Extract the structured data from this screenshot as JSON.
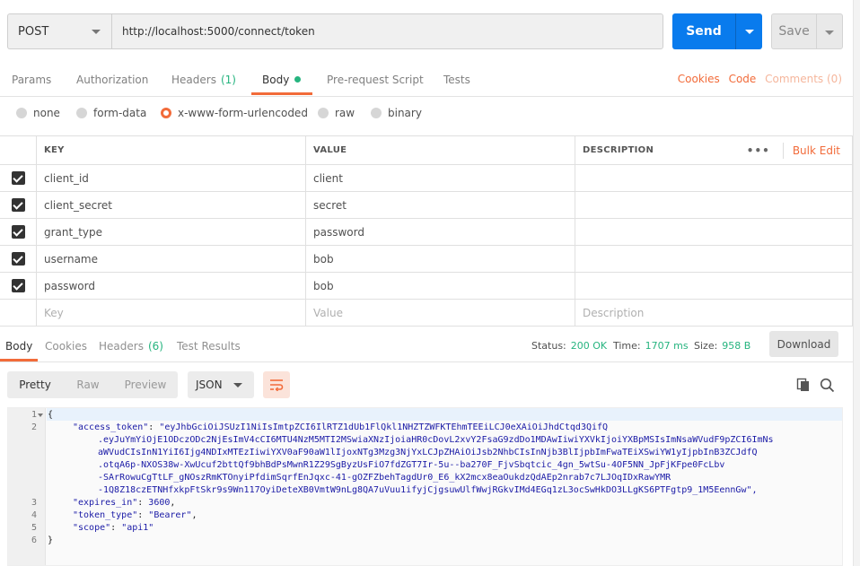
{
  "request": {
    "method": "POST",
    "url": "http://localhost:5000/connect/token",
    "send_label": "Send",
    "save_label": "Save"
  },
  "tabs": {
    "params": "Params",
    "authorization": "Authorization",
    "headers": "Headers",
    "headers_count": "(1)",
    "body": "Body",
    "prerequest": "Pre-request Script",
    "tests": "Tests",
    "cookies": "Cookies",
    "code": "Code",
    "comments": "Comments (0)"
  },
  "body_types": [
    "none",
    "form-data",
    "x-www-form-urlencoded",
    "raw",
    "binary"
  ],
  "body_type_selected": "x-www-form-urlencoded",
  "table": {
    "headers": {
      "key": "KEY",
      "value": "VALUE",
      "description": "DESCRIPTION"
    },
    "menu": "•••",
    "bulk_edit": "Bulk Edit",
    "rows": [
      {
        "key": "client_id",
        "value": "client",
        "description": ""
      },
      {
        "key": "client_secret",
        "value": "secret",
        "description": ""
      },
      {
        "key": "grant_type",
        "value": "password",
        "description": ""
      },
      {
        "key": "username",
        "value": "bob",
        "description": ""
      },
      {
        "key": "password",
        "value": "bob",
        "description": ""
      }
    ],
    "placeholder": {
      "key": "Key",
      "value": "Value",
      "description": "Description"
    }
  },
  "response": {
    "tabs": {
      "body": "Body",
      "cookies": "Cookies",
      "headers": "Headers",
      "headers_count": "(6)",
      "tests": "Test Results"
    },
    "status_label": "Status:",
    "status_value": "200 OK",
    "time_label": "Time:",
    "time_value": "1707 ms",
    "size_label": "Size:",
    "size_value": "958 B",
    "download": "Download"
  },
  "viewer": {
    "pretty": "Pretty",
    "raw": "Raw",
    "preview": "Preview",
    "format": "JSON"
  },
  "code": {
    "line_numbers": [
      "1",
      "2",
      "3",
      "4",
      "5",
      "6"
    ],
    "open_brace": "{",
    "close_brace": "}",
    "access_token_key": "\"access_token\"",
    "token_lines": [
      "\"eyJhbGciOiJSUzI1NiIsImtpZCI6IlRTZ1dUb1FlQkl1NHZTZWFKTEhmTEEiLCJ0eXAiOiJhdCtqd3QifQ",
      ".eyJuYmYiOjE1ODczODc2NjEsImV4cCI6MTU4NzM5MTI2MSwiaXNzIjoiaHR0cDovL2xvY2FsaG9zdDo1MDAwIiwiYXVkIjoiYXBpMSIsImNsaWVudF9pZCI6ImNs",
      "aWVudCIsInN1YiI6Ijg4NDIxMTEzIiwiYXV0aF90aW1lIjoxNTg3Mzg3NjYxLCJpZHAiOiJsb2NhbCIsInNjb3BlIjpbImFwaTEiXSwiYW1yIjpbInB3ZCJdfQ",
      ".otqA6p-NXOS38w-XwUcuf2bttQf9bhBdPsMwnR1Z29SgByzUsFiO7fdZGT7Ir-5u--ba270F_FjvSbqtcic_4gn_5wtSu-4OF5NN_JpFjKFpe0FcLbv",
      "-SArRowuCgTtLF_gNOszRmKTOnyiPfdimSqrfEnJqxc-41-gOZFZbehTagdUr0_E6_kX2mcx8eaOukdzQdAEp2nrab7c7LJOqIDxRawYMR",
      "-1Q8Z18czETNHfxkpFtSkr9s9Wn117OyiDeteXB0VmtW9nLg8QA7uVuu1ifyjCjgsuwUlfWwjRGkvIMd4EGq1zL3ocSwHkDO3LLgKS6PTFgtp9_1M5EennGw\","
    ],
    "expires_key": "\"expires_in\"",
    "expires_value": "3600",
    "token_type_key": "\"token_type\"",
    "token_type_value": "\"Bearer\"",
    "scope_key": "\"scope\"",
    "scope_value": "\"api1\""
  },
  "colors": {
    "send": "#097bed",
    "accent": "#f26b3a",
    "success": "#26b47f"
  }
}
